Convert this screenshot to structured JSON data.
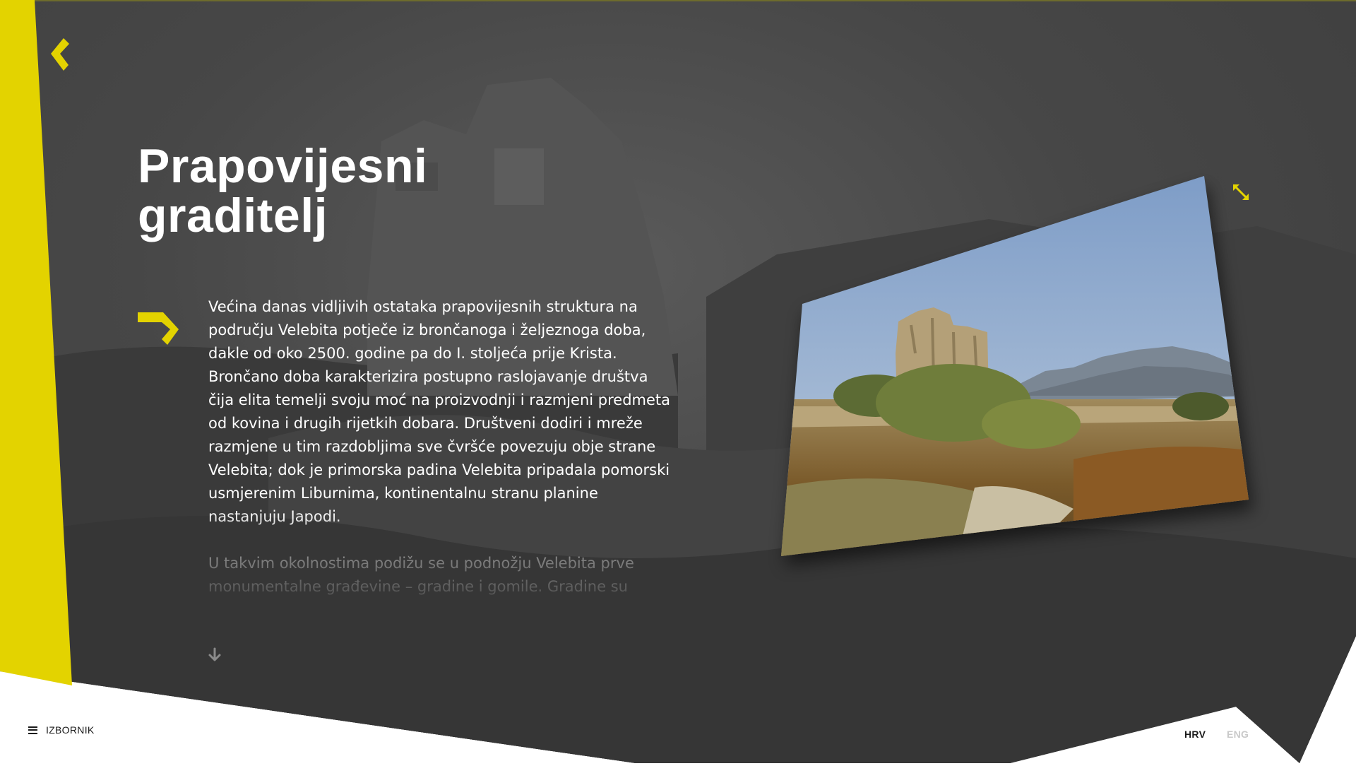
{
  "colors": {
    "accent": "#e3d300",
    "background": "#474747",
    "text_light": "#ffffff",
    "text_dark": "#1a1a1a",
    "inactive": "#c9c9c9"
  },
  "header": {
    "logo_icon": "chevron-logo-icon"
  },
  "main": {
    "title": "Prapovijesni\ngraditelj",
    "paragraphs": [
      "Većina danas vidljivih ostataka prapovijesnih struktura na području Velebita potječe iz brončanoga i željeznoga doba, dakle od oko 2500. godine pa do I. stoljeća prije Krista. Brončano doba karakterizira postupno raslojavanje društva čija elita temelji svoju moć na proizvodnji i razmjeni predmeta od kovina i drugih rijetkih dobara. Društveni dodiri i mreže razmjene u tim razdobljima sve čvršće povezuju obje strane Velebita; dok je primorska padina Velebita pripadala pomorski usmjerenim Liburnima, kontinentalnu stranu planine nastanjuju Japodi.",
      "U takvim okolnostima podižu se u podnožju Velebita prve monumentalne građevine – gradine i gomile. Gradine su"
    ],
    "arrow_icon": "arrow-right-icon",
    "scroll_icon": "arrow-down-icon"
  },
  "gallery": {
    "image_subject": "stone tower ruin with Velebit mountains",
    "expand_icon": "expand-icon"
  },
  "footer": {
    "menu_label": "IZBORNIK",
    "menu_icon": "hamburger-icon",
    "languages": [
      "HRV",
      "ENG"
    ],
    "active_language": "HRV"
  }
}
